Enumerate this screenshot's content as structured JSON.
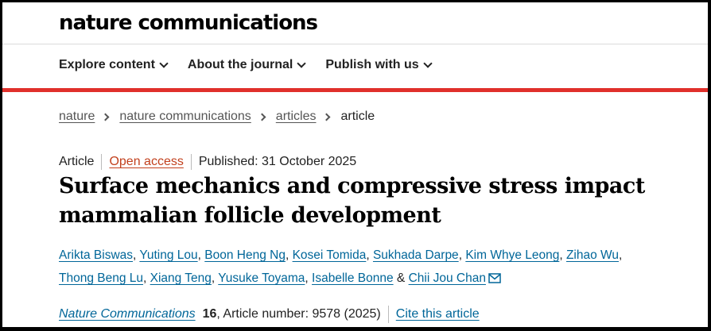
{
  "header": {
    "logo": "nature communications",
    "nav": [
      {
        "label": "Explore content"
      },
      {
        "label": "About the journal"
      },
      {
        "label": "Publish with us"
      }
    ],
    "accent_color": "#e0302b"
  },
  "breadcrumbs": [
    "nature",
    "nature communications",
    "articles",
    "article"
  ],
  "article": {
    "type": "Article",
    "access": "Open access",
    "published": "Published: 31 October 2025",
    "title": "Surface mechanics and compressive stress impact mammalian follicle development",
    "authors": [
      "Arikta Biswas",
      "Yuting Lou",
      "Boon Heng Ng",
      "Kosei Tomida",
      "Sukhada Darpe",
      "Kim Whye Leong",
      "Zihao Wu",
      "Thong Beng Lu",
      "Xiang Teng",
      "Yusuke Toyama",
      "Isabelle Bonne",
      "Chii Jou Chan"
    ],
    "author_and": "&",
    "mail_icon": "envelope-icon",
    "citation": {
      "journal": "Nature Communications",
      "volume": "16",
      "rest": ", Article number: 9578 (2025)",
      "cite_label": "Cite this article"
    },
    "link_color": "#006699",
    "open_access_color": "#c2401d"
  }
}
